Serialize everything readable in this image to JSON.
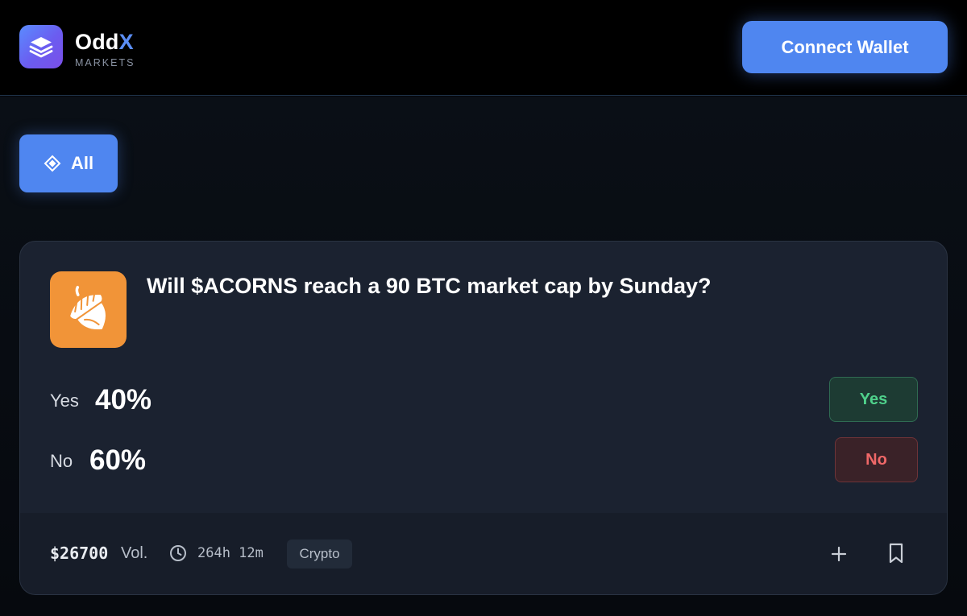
{
  "header": {
    "brand_name_main": "Odd",
    "brand_name_accent": "X",
    "brand_sub": "MARKETS",
    "connect_label": "Connect Wallet",
    "logo_icon": "layers-icon",
    "accent_color": "#4f86f0"
  },
  "filters": {
    "all_label": "All",
    "all_icon": "diamond-icon"
  },
  "market": {
    "icon": "acorn-icon",
    "question": "Will $ACORNS reach a 90 BTC market cap by Sunday?",
    "outcomes": [
      {
        "label": "Yes",
        "percent": "40%",
        "button": "Yes",
        "color": "#4fd18b"
      },
      {
        "label": "No",
        "percent": "60%",
        "button": "No",
        "color": "#f06868"
      }
    ],
    "footer": {
      "volume": "$26700",
      "volume_label": "Vol.",
      "time_left": "264h 12m",
      "tag": "Crypto",
      "plus_icon": "plus-icon",
      "bookmark_icon": "bookmark-icon"
    }
  }
}
